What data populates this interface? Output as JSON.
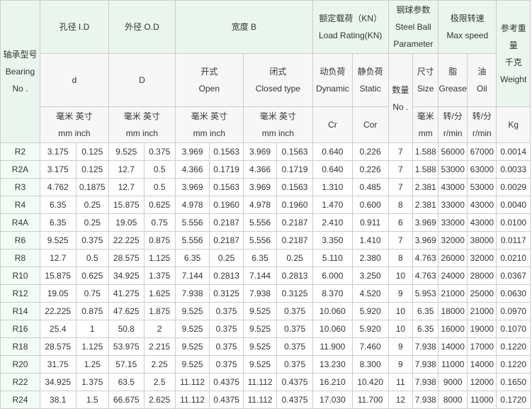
{
  "headers": {
    "model": [
      "轴承型号",
      "Bearing",
      "No ."
    ],
    "bore": "孔径 I.D",
    "outer": "外径 O.D",
    "width": "宽度 B",
    "load": [
      "额定载荷（KN）",
      "Load Rating(KN)"
    ],
    "ball": [
      "钢球参数",
      "Steel Ball",
      "Parameter"
    ],
    "speed": [
      "极限转速",
      "Max speed"
    ],
    "weight": [
      "参考重",
      "量",
      "千克",
      "Weight",
      "Kg"
    ],
    "d": "d",
    "D": "D",
    "open": [
      "开式",
      "Open"
    ],
    "closed": [
      "闭式",
      "Closed type"
    ],
    "dynamic": [
      "动负荷",
      "Dynamic"
    ],
    "static": [
      "静负荷",
      "Static"
    ],
    "count": [
      "数量",
      "No ."
    ],
    "size": [
      "尺寸",
      "Size"
    ],
    "grease": [
      "脂",
      "Grease"
    ],
    "oil": [
      "油",
      "Oil"
    ],
    "unit_mm_inch": [
      "毫米 英寸",
      "mm inch"
    ],
    "cr": "Cr",
    "cor": "Cor",
    "unit_mm": [
      "毫米",
      "mm"
    ],
    "unit_rpm": [
      "转/分",
      "r/min"
    ]
  },
  "rows": [
    [
      "R2",
      "3.175",
      "0.125",
      "9.525",
      "0.375",
      "3.969",
      "0.1563",
      "3.969",
      "0.1563",
      "0.640",
      "0.226",
      "7",
      "1.588",
      "56000",
      "67000",
      "0.0014"
    ],
    [
      "R2A",
      "3.175",
      "0.125",
      "12.7",
      "0.5",
      "4.366",
      "0.1719",
      "4.366",
      "0.1719",
      "0.640",
      "0.226",
      "7",
      "1.588",
      "53000",
      "63000",
      "0.0033"
    ],
    [
      "R3",
      "4.762",
      "0.1875",
      "12.7",
      "0.5",
      "3.969",
      "0.1563",
      "3.969",
      "0.1563",
      "1.310",
      "0.485",
      "7",
      "2.381",
      "43000",
      "53000",
      "0.0029"
    ],
    [
      "R4",
      "6.35",
      "0.25",
      "15.875",
      "0.625",
      "4.978",
      "0.1960",
      "4.978",
      "0.1960",
      "1.470",
      "0.600",
      "8",
      "2.381",
      "33000",
      "43000",
      "0.0040"
    ],
    [
      "R4A",
      "6.35",
      "0.25",
      "19.05",
      "0.75",
      "5.556",
      "0.2187",
      "5.556",
      "0.2187",
      "2.410",
      "0.911",
      "6",
      "3.969",
      "33000",
      "43000",
      "0.0100"
    ],
    [
      "R6",
      "9.525",
      "0.375",
      "22.225",
      "0.875",
      "5.556",
      "0.2187",
      "5.556",
      "0.2187",
      "3.350",
      "1.410",
      "7",
      "3.969",
      "32000",
      "38000",
      "0.0117"
    ],
    [
      "R8",
      "12.7",
      "0.5",
      "28.575",
      "1.125",
      "6.35",
      "0.25",
      "6.35",
      "0.25",
      "5.110",
      "2.380",
      "8",
      "4.763",
      "26000",
      "32000",
      "0.0210"
    ],
    [
      "R10",
      "15.875",
      "0.625",
      "34.925",
      "1.375",
      "7.144",
      "0.2813",
      "7.144",
      "0.2813",
      "6.000",
      "3.250",
      "10",
      "4.763",
      "24000",
      "28000",
      "0.0367"
    ],
    [
      "R12",
      "19.05",
      "0.75",
      "41.275",
      "1.625",
      "7.938",
      "0.3125",
      "7.938",
      "0.3125",
      "8.370",
      "4.520",
      "9",
      "5.953",
      "21000",
      "25000",
      "0.0630"
    ],
    [
      "R14",
      "22.225",
      "0.875",
      "47.625",
      "1.875",
      "9.525",
      "0.375",
      "9.525",
      "0.375",
      "10.060",
      "5.920",
      "10",
      "6.35",
      "18000",
      "21000",
      "0.0970"
    ],
    [
      "R16",
      "25.4",
      "1",
      "50.8",
      "2",
      "9.525",
      "0.375",
      "9.525",
      "0.375",
      "10.060",
      "5.920",
      "10",
      "6.35",
      "16000",
      "19000",
      "0.1070"
    ],
    [
      "R18",
      "28.575",
      "1.125",
      "53.975",
      "2.215",
      "9.525",
      "0.375",
      "9.525",
      "0.375",
      "11.900",
      "7.460",
      "9",
      "7.938",
      "14000",
      "17000",
      "0.1220"
    ],
    [
      "R20",
      "31.75",
      "1.25",
      "57.15",
      "2.25",
      "9.525",
      "0.375",
      "9.525",
      "0.375",
      "13.230",
      "8.300",
      "9",
      "7.938",
      "11000",
      "14000",
      "0.1220"
    ],
    [
      "R22",
      "34.925",
      "1.375",
      "63.5",
      "2.5",
      "11.112",
      "0.4375",
      "11.112",
      "0.4375",
      "16.210",
      "10.420",
      "11",
      "7.938",
      "9000",
      "12000",
      "0.1650"
    ],
    [
      "R24",
      "38.1",
      "1.5",
      "66.675",
      "2.625",
      "11.112",
      "0.4375",
      "11.112",
      "0.4375",
      "17.030",
      "11.700",
      "12",
      "7.938",
      "8000",
      "11000",
      "0.1720"
    ]
  ]
}
